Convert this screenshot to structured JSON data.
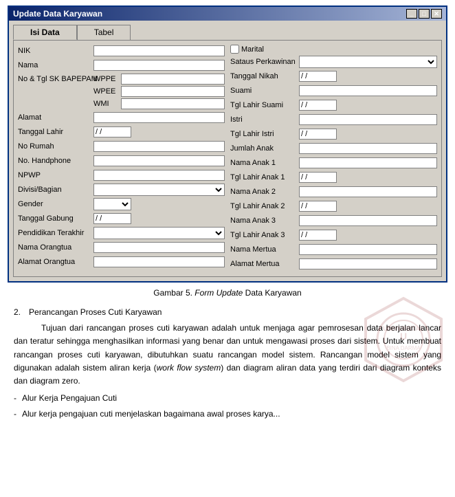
{
  "window": {
    "title": "Update Data Karyawan",
    "close_btn": "✕",
    "min_btn": "_",
    "max_btn": "□"
  },
  "tabs": {
    "tab1": "Isi Data",
    "tab2": "Tabel"
  },
  "left_form": {
    "fields": [
      {
        "id": "nik",
        "label": "NIK",
        "type": "input",
        "value": ""
      },
      {
        "id": "nama",
        "label": "Nama",
        "type": "input",
        "value": ""
      },
      {
        "id": "no_tgl_sk",
        "label": "No & Tgl SK BAPEPAM",
        "type": "subrows",
        "subrows": [
          {
            "sublabel": "WPPE",
            "value": ""
          },
          {
            "sublabel": "WPEE",
            "value": ""
          },
          {
            "sublabel": "WMI",
            "value": ""
          }
        ]
      },
      {
        "id": "alamat",
        "label": "Alamat",
        "type": "input",
        "value": ""
      },
      {
        "id": "tgl_lahir",
        "label": "Tanggal Lahir",
        "type": "date",
        "value": "/ /"
      },
      {
        "id": "no_rumah",
        "label": "No Rumah",
        "type": "input",
        "value": ""
      },
      {
        "id": "no_handphone",
        "label": "No. Handphone",
        "type": "input",
        "value": ""
      },
      {
        "id": "npwp",
        "label": "NPWP",
        "type": "input",
        "value": ""
      },
      {
        "id": "divisi",
        "label": "Divisi/Bagian",
        "type": "select",
        "value": ""
      },
      {
        "id": "gender",
        "label": "Gender",
        "type": "select",
        "value": ""
      },
      {
        "id": "tgl_gabung",
        "label": "Tanggal Gabung",
        "type": "date",
        "value": "/ /"
      },
      {
        "id": "pendidikan",
        "label": "Pendidikan Terakhir",
        "type": "select",
        "value": ""
      },
      {
        "id": "nama_orangtua",
        "label": "Nama Orangtua",
        "type": "input",
        "value": ""
      },
      {
        "id": "alamat_orangtua",
        "label": "Alamat Orangtua",
        "type": "input",
        "value": ""
      }
    ]
  },
  "right_form": {
    "marital_label": "Marital",
    "fields": [
      {
        "id": "status_perkawinan",
        "label": "Sataus Perkawinan",
        "type": "select",
        "value": ""
      },
      {
        "id": "tgl_nikah",
        "label": "Tanggal Nikah",
        "type": "date",
        "value": "/ /"
      },
      {
        "id": "suami",
        "label": "Suami",
        "type": "input",
        "value": ""
      },
      {
        "id": "tgl_lahir_suami",
        "label": "Tgl Lahir Suami",
        "type": "date",
        "value": "/ /"
      },
      {
        "id": "istri",
        "label": "Istri",
        "type": "input",
        "value": ""
      },
      {
        "id": "tgl_lahir_istri",
        "label": "Tgl Lahir Istri",
        "type": "date",
        "value": "/ /"
      },
      {
        "id": "jumlah_anak",
        "label": "Jumlah Anak",
        "type": "input",
        "value": ""
      },
      {
        "id": "nama_anak1",
        "label": "Nama Anak 1",
        "type": "input",
        "value": ""
      },
      {
        "id": "tgl_lahir_anak1",
        "label": "Tgl Lahir Anak 1",
        "type": "date",
        "value": "/ /"
      },
      {
        "id": "nama_anak2",
        "label": "Nama Anak 2",
        "type": "input",
        "value": ""
      },
      {
        "id": "tgl_lahir_anak2",
        "label": "Tgl Lahir Anak 2",
        "type": "date",
        "value": "/ /"
      },
      {
        "id": "nama_anak3",
        "label": "Nama Anak 3",
        "type": "input",
        "value": ""
      },
      {
        "id": "tgl_lahir_anak3",
        "label": "Tgl Lahir Anak 3",
        "type": "date",
        "value": "/ /"
      },
      {
        "id": "nama_mertua",
        "label": "Nama Mertua",
        "type": "input",
        "value": ""
      },
      {
        "id": "alamat_mertua",
        "label": "Alamat Mertua",
        "type": "input",
        "value": ""
      }
    ]
  },
  "figure": {
    "caption_prefix": "Gambar 5. ",
    "caption_italic": "Form Update",
    "caption_suffix": " Data Karyawan"
  },
  "body": {
    "section_num": "2.",
    "section_title": "Perancangan Proses Cuti Karyawan",
    "paragraphs": [
      "Tujuan dari rancangan proses cuti karyawan adalah untuk menjaga agar pemrosesan data berjalan lancar dan teratur sehingga menghasilkan informasi yang benar dan untuk mengawasi proses dari sistem. Untuk membuat rancangan proses cuti karyawan, dibutuhkan suatu rancangan model sistem. Rancangan model sistem yang digunakan adalah sistem aliran kerja (work flow system) dan diagram aliran data yang terdiri dari diagram konteks dan diagram zero."
    ],
    "bullet_label": "-",
    "bullet_text": "Alur Kerja Pengajuan Cuti",
    "bullet2_label": "-",
    "bullet2_text": "Alur kerja pengajuan cuti menjelaskan bagaimana awal proses karya..."
  }
}
